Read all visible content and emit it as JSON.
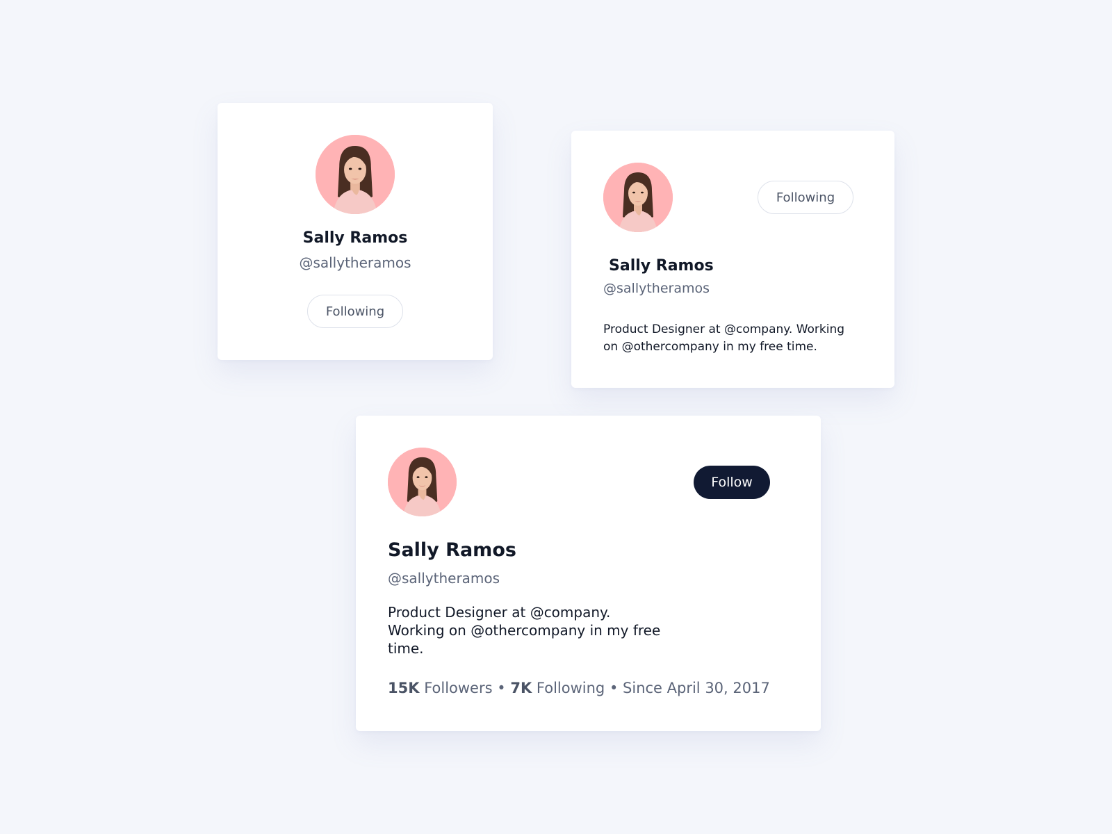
{
  "colors": {
    "background": "#f4f6fb",
    "card": "#ffffff",
    "avatar_bg": "#ffb3b5",
    "name_text": "#111827",
    "handle_text": "#5b6478",
    "follow_button_bg": "#111a33",
    "follow_button_text": "#ffffff",
    "outline_border": "#dde1ea"
  },
  "card_compact": {
    "avatar_icon": "profile-photo",
    "name": "Sally Ramos",
    "handle": "@sallytheramos",
    "button_label": "Following"
  },
  "card_medium": {
    "avatar_icon": "profile-photo",
    "name": "Sally Ramos",
    "handle": "@sallytheramos",
    "button_label": "Following",
    "bio_line1": "Product Designer at @company. Working",
    "bio_line2": "on @othercompany in my free time."
  },
  "card_large": {
    "avatar_icon": "profile-photo",
    "name": "Sally Ramos",
    "handle": "@sallytheramos",
    "button_label": "Follow",
    "bio_line1": "Product Designer at @company.",
    "bio_line2": "Working on @othercompany in my free",
    "bio_line3": "time.",
    "stats": {
      "followers_count": "15K",
      "followers_label": "Followers",
      "separator": "•",
      "following_count": "7K",
      "following_label": "Following",
      "since_label": "Since April 30, 2017"
    }
  }
}
